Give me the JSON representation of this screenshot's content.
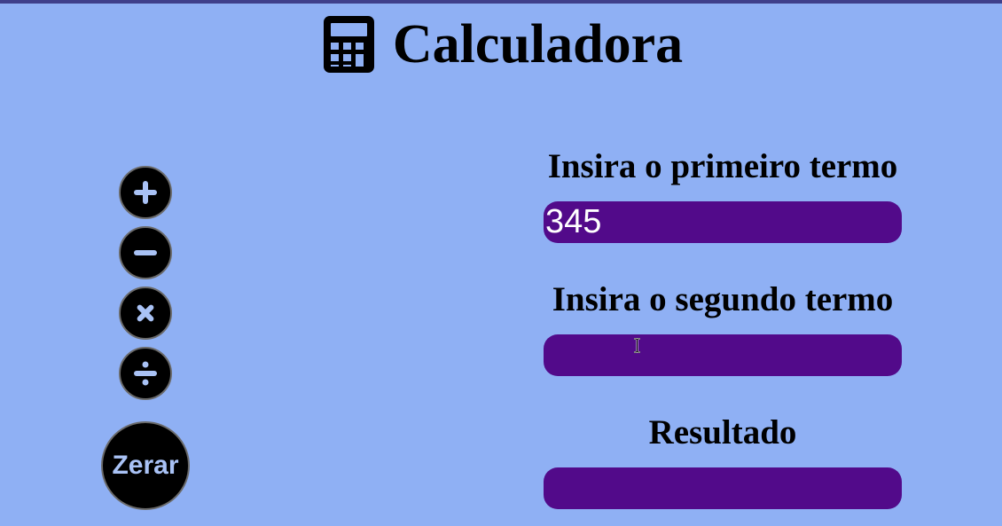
{
  "header": {
    "title": "Calculadora",
    "icon": "calculator-icon"
  },
  "operations": [
    {
      "name": "add",
      "icon": "plus-icon",
      "symbol": "+"
    },
    {
      "name": "subtract",
      "icon": "minus-icon",
      "symbol": "−"
    },
    {
      "name": "multiply",
      "icon": "times-icon",
      "symbol": "×"
    },
    {
      "name": "divide",
      "icon": "divide-icon",
      "symbol": "÷"
    }
  ],
  "reset": {
    "label": "Zerar"
  },
  "fields": {
    "first": {
      "label": "Insira o primeiro termo",
      "value": "345",
      "placeholder": ""
    },
    "second": {
      "label": "Insira o segundo termo",
      "value": "",
      "placeholder": ""
    },
    "result": {
      "label": "Resultado",
      "value": "",
      "placeholder": ""
    }
  },
  "colors": {
    "background": "#8fb0f4",
    "field": "#520a8a",
    "button": "#000000",
    "reset_text": "#a9c2f5",
    "icon_glyph": "#a9c2f5"
  }
}
